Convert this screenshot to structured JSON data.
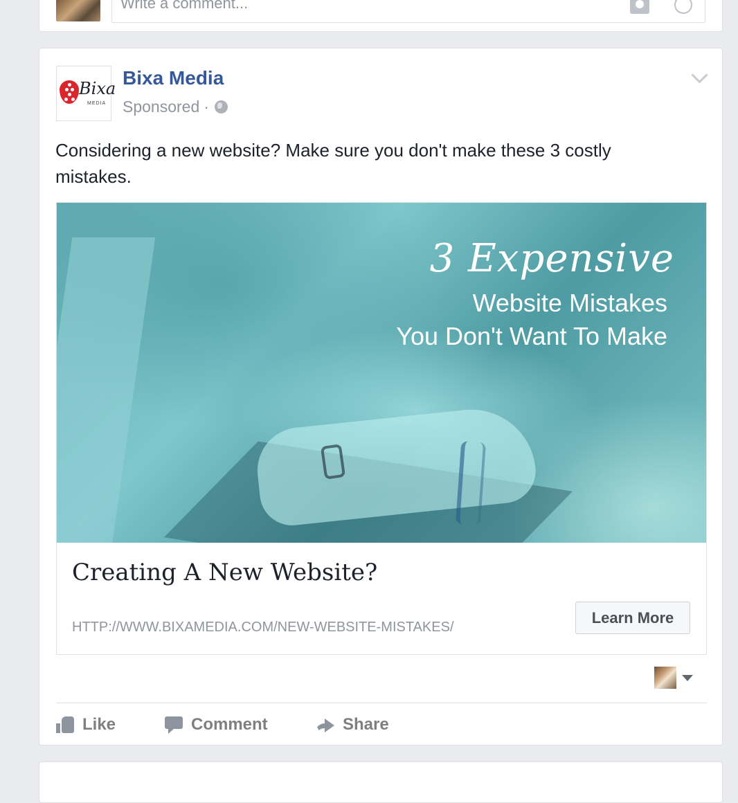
{
  "comment_composer": {
    "placeholder": "Write a comment...",
    "camera_icon": "camera-icon",
    "emoji_icon": "emoji-icon"
  },
  "post": {
    "page_name": "Bixa Media",
    "logo": {
      "word": "Bixa",
      "sub": "MEDIA",
      "brand_color": "#d9252b"
    },
    "sponsored_label": "Sponsored",
    "separator": "·",
    "privacy_icon": "globe-icon",
    "text": "Considering a new website? Make sure you don't make these 3 costly mistakes.",
    "attachment": {
      "image_text": {
        "line1": "3 Expensive",
        "line2": "Website Mistakes",
        "line3": "You Don't Want To Make"
      },
      "title": "Creating A New Website?",
      "url": "HTTP://WWW.BIXAMEDIA.COM/NEW-WEBSITE-MISTAKES/",
      "cta_label": "Learn More"
    },
    "actions": {
      "like": "Like",
      "comment": "Comment",
      "share": "Share"
    }
  },
  "colors": {
    "link_blue": "#365899",
    "feed_bg": "#e9ebee",
    "muted_text": "#90949c"
  }
}
